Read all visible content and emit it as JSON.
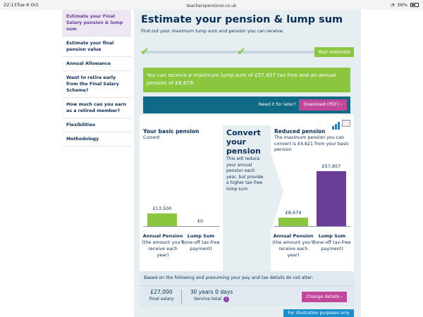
{
  "status": {
    "time": "22:13",
    "date": "Tue 6 Oct",
    "url": "teacherspensions.co.uk",
    "battery": "56%"
  },
  "sidebar": {
    "items": [
      {
        "label": "Estimate your Final Salary pension & lump sum",
        "active": true
      },
      {
        "label": "Estimate your final pension value",
        "active": false
      },
      {
        "label": "Annual Allowance",
        "active": false
      },
      {
        "label": "Want to retire early from the Final Salary Scheme?",
        "active": false
      },
      {
        "label": "How much can you earn as a retired member?",
        "active": false
      },
      {
        "label": "Flexibilities",
        "active": false
      },
      {
        "label": "Methodology",
        "active": false
      }
    ]
  },
  "page": {
    "title": "Estimate your pension & lump sum",
    "subtitle": "Find out your maximum lump sum and pension you can receive.",
    "step_badge": "Your estimate",
    "result_text": "You can receive a maximum lump sum of £57,857 tax free and an annual pension of £8,679.",
    "need_it": "Need it for later?",
    "download_label": "Download (PDF) ›"
  },
  "basic": {
    "heading": "Your basic pension",
    "sub": "Current",
    "pension_value": "£13,500",
    "lump_value": "£0",
    "pension_amount": 13500,
    "lump_amount": 0
  },
  "convert": {
    "heading": "Convert your pension",
    "text": "This will reduce your annual pension each year, but provide a higher tax-free lump sum"
  },
  "reduced": {
    "heading": "Reduced pension",
    "sub": "The maximum pension you can convert is £4,821 from your basic pension",
    "pension_value": "£8,679",
    "lump_value": "£57,857",
    "pension_amount": 8679,
    "lump_amount": 57857
  },
  "labels": {
    "pension_title": "Annual Pension",
    "pension_desc": "(the amount you'll receive each year)",
    "lump_title": "Lump Sum",
    "lump_desc": "(one-off tax-free payment)"
  },
  "bottom": {
    "intro": "Based on the following and presuming your pay and tax details do not alter:",
    "salary_value": "£27,000",
    "salary_label": "Final salary",
    "service_value": "30 years 0 days",
    "service_label": "Service total",
    "change_label": "Change details ›",
    "illustration": "For illustration purposes only"
  },
  "colors": {
    "green": "#8cc63e",
    "purple": "#6a3d98",
    "magenta": "#c1479a",
    "teal": "#0f6a85",
    "navy": "#0b2e55"
  }
}
